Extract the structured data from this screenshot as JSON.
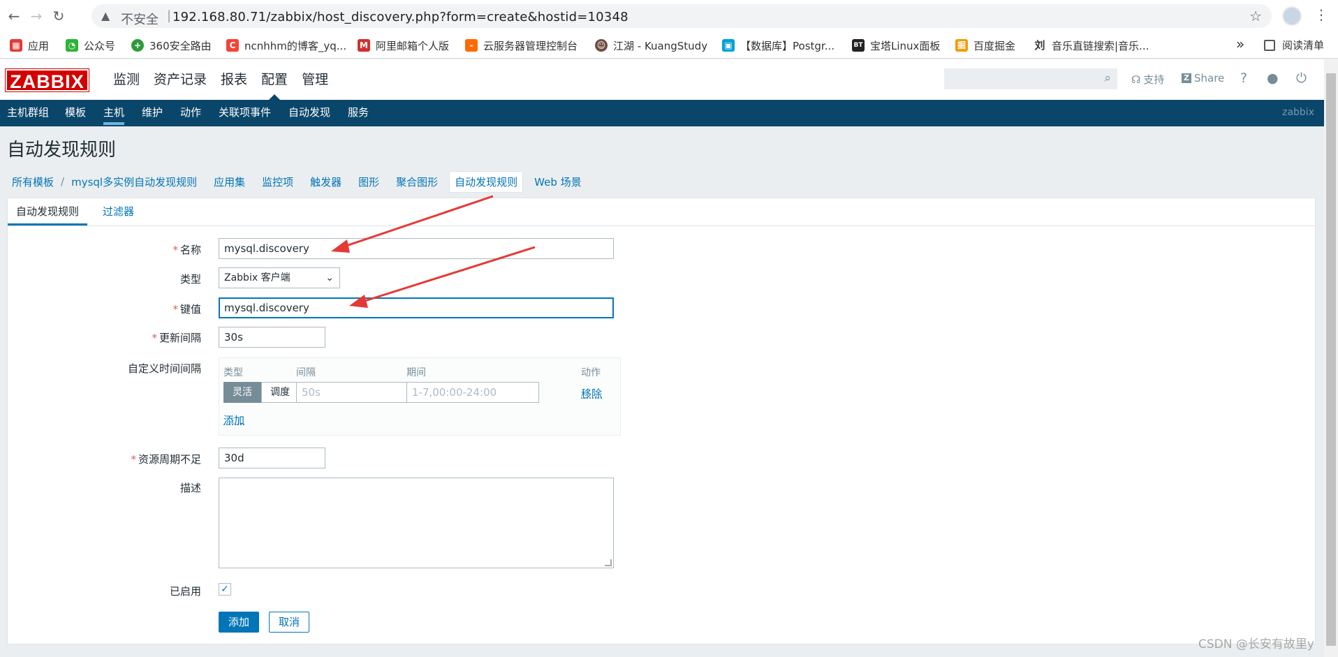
{
  "browser": {
    "url_insecure_label": "不安全",
    "url_separator": "|",
    "url": "192.168.80.71/zabbix/host_discovery.php?form=create&hostid=10348",
    "bookmarks": [
      {
        "label": "应用",
        "icon": "apps-grid-icon",
        "color": "#e53935"
      },
      {
        "label": "公众号",
        "icon": "wechat-icon",
        "color": "#2db336"
      },
      {
        "label": "360安全路由",
        "icon": "360-icon",
        "color": "#2e9b3a"
      },
      {
        "label": "ncnhhm的博客_yq...",
        "icon": "csdn-icon",
        "color": "#f44336"
      },
      {
        "label": "阿里邮箱个人版",
        "icon": "mail-icon",
        "color": "#d32f2f"
      },
      {
        "label": "云服务器管理控制台",
        "icon": "aliyun-icon",
        "color": "#ff6a00"
      },
      {
        "label": "江湖 - KuangStudy",
        "icon": "kuang-icon",
        "color": "#6d4c41"
      },
      {
        "label": "【数据库】Postgr...",
        "icon": "bilibili-icon",
        "color": "#00a1d6"
      },
      {
        "label": "宝塔Linux面板",
        "icon": "bt-icon",
        "color": "#222222"
      },
      {
        "label": "百度掘金",
        "icon": "juejin-icon",
        "color": "#f59b00"
      },
      {
        "label": "音乐直链搜索|音乐...",
        "icon": "music-icon",
        "color": "#333333"
      }
    ],
    "bookmarks_more": "»",
    "reading_list": "阅读清单"
  },
  "header": {
    "logo": "ZABBIX",
    "menu": [
      "监测",
      "资产记录",
      "报表",
      "配置",
      "管理"
    ],
    "support": "支持",
    "share": "Share",
    "help": "?"
  },
  "submenu": {
    "items": [
      "主机群组",
      "模板",
      "主机",
      "维护",
      "动作",
      "关联项事件",
      "自动发现",
      "服务"
    ],
    "server_name": "zabbix"
  },
  "page": {
    "title": "自动发现规则",
    "breadcrumbs": [
      "所有模板",
      "/",
      "mysql多实例自动发现规则",
      "应用集",
      "监控项",
      "触发器",
      "图形",
      "聚合图形",
      "自动发现规则",
      "Web 场景"
    ]
  },
  "form": {
    "tabs": [
      "自动发现规则",
      "过滤器"
    ],
    "name_label": "名称",
    "name_value": "mysql.discovery",
    "type_label": "类型",
    "type_value": "Zabbix 客户端",
    "key_label": "键值",
    "key_value": "mysql.discovery",
    "interval_label": "更新间隔",
    "interval_value": "30s",
    "custom_label": "自定义时间间隔",
    "custom_headers": [
      "类型",
      "间隔",
      "期间",
      "动作"
    ],
    "custom_types": [
      "灵活",
      "调度"
    ],
    "custom_interval_placeholder": "50s",
    "custom_period_placeholder": "1-7,00:00-24:00",
    "remove_link": "移除",
    "add_link": "添加",
    "lifetime_label": "资源周期不足",
    "lifetime_value": "30d",
    "description_label": "描述",
    "enabled_label": "已启用",
    "enabled": true,
    "add_button": "添加",
    "cancel_button": "取消"
  },
  "watermark": "CSDN @长安有故里y"
}
